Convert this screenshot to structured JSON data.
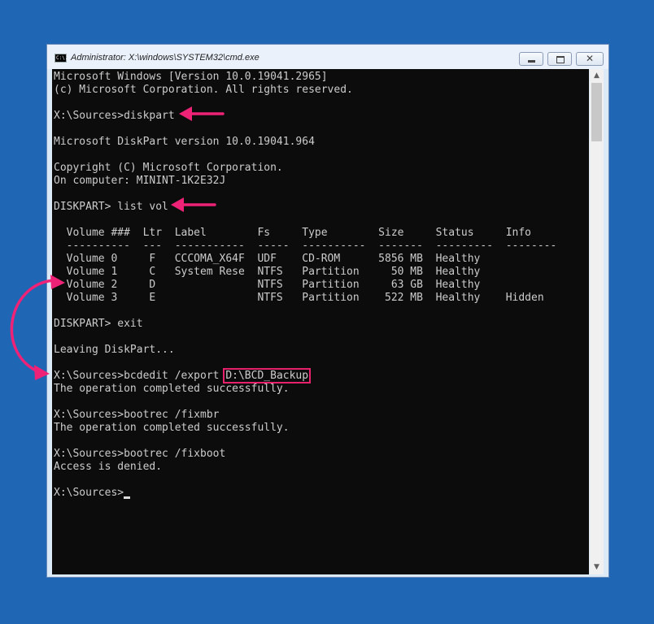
{
  "window": {
    "title": "Administrator: X:\\windows\\SYSTEM32\\cmd.exe",
    "app_icon": "cmd-icon",
    "app_icon_text": "C:\\.",
    "controls": {
      "minimize": "minimize-icon",
      "maximize": "maximize-icon",
      "close": "close-icon",
      "close_glyph": "✕"
    }
  },
  "console": {
    "lines": [
      "Microsoft Windows [Version 10.0.19041.2965]",
      "(c) Microsoft Corporation. All rights reserved.",
      "",
      "X:\\Sources>diskpart",
      "",
      "Microsoft DiskPart version 10.0.19041.964",
      "",
      "Copyright (C) Microsoft Corporation.",
      "On computer: MININT-1K2E32J",
      "",
      "DISKPART> list vol",
      "",
      "  Volume ###  Ltr  Label        Fs     Type        Size     Status     Info",
      "  ----------  ---  -----------  -----  ----------  -------  ---------  --------",
      "  Volume 0     F   CCCOMA_X64F  UDF    CD-ROM      5856 MB  Healthy",
      "  Volume 1     C   System Rese  NTFS   Partition     50 MB  Healthy",
      "  Volume 2     D                NTFS   Partition     63 GB  Healthy",
      "  Volume 3     E                NTFS   Partition    522 MB  Healthy    Hidden",
      "",
      "DISKPART> exit",
      "",
      "Leaving DiskPart...",
      "",
      "X:\\Sources>bcdedit /export ",
      "The operation completed successfully.",
      "",
      "X:\\Sources>bootrec /fixmbr",
      "The operation completed successfully.",
      "",
      "X:\\Sources>bootrec /fixboot",
      "Access is denied.",
      "",
      "X:\\Sources>"
    ],
    "highlighted_path": "D:\\BCD_Backup",
    "highlight_color": "#e8216d",
    "text_color": "#cccccc",
    "background": "#0c0c0c"
  },
  "scrollbar": {
    "up": "▲",
    "down": "▼"
  },
  "annotations": {
    "arrow_color": "#ee2277"
  },
  "desktop_color": "#1f66b4"
}
